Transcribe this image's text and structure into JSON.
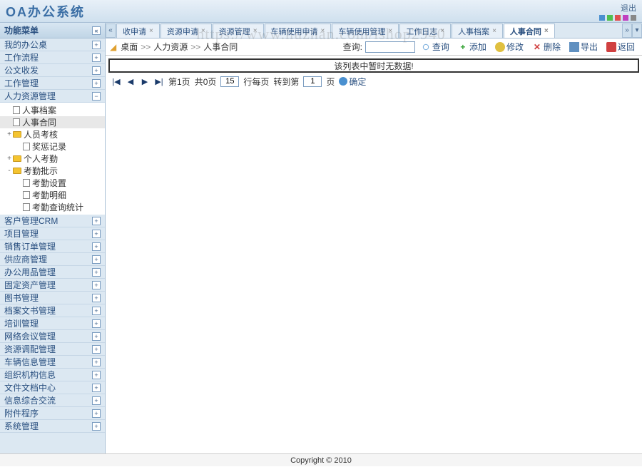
{
  "header": {
    "title": "OA办公系统",
    "logout": "退出"
  },
  "watermark": "https://www.huzhan.com/ishop2940",
  "sidebar": {
    "header": "功能菜单",
    "items": [
      {
        "label": "我的办公桌",
        "expanded": false
      },
      {
        "label": "工作流程",
        "expanded": false
      },
      {
        "label": "公文收发",
        "expanded": false
      },
      {
        "label": "工作管理",
        "expanded": false
      },
      {
        "label": "人力资源管理",
        "expanded": true
      },
      {
        "label": "客户管理CRM",
        "expanded": false
      },
      {
        "label": "项目管理",
        "expanded": false
      },
      {
        "label": "销售订单管理",
        "expanded": false
      },
      {
        "label": "供应商管理",
        "expanded": false
      },
      {
        "label": "办公用品管理",
        "expanded": false
      },
      {
        "label": "固定资产管理",
        "expanded": false
      },
      {
        "label": "图书管理",
        "expanded": false
      },
      {
        "label": "档案文书管理",
        "expanded": false
      },
      {
        "label": "培训管理",
        "expanded": false
      },
      {
        "label": "网络会议管理",
        "expanded": false
      },
      {
        "label": "资源调配管理",
        "expanded": false
      },
      {
        "label": "车辆信息管理",
        "expanded": false
      },
      {
        "label": "组织机构信息",
        "expanded": false
      },
      {
        "label": "文件文档中心",
        "expanded": false
      },
      {
        "label": "信息综合交流",
        "expanded": false
      },
      {
        "label": "附件程序",
        "expanded": false
      },
      {
        "label": "系统管理",
        "expanded": false
      }
    ],
    "tree": [
      {
        "label": "人事档案",
        "type": "file",
        "level": 1
      },
      {
        "label": "人事合同",
        "type": "file",
        "level": 1,
        "selected": true
      },
      {
        "label": "人员考核",
        "type": "folder",
        "level": 1,
        "exp": "+"
      },
      {
        "label": "奖惩记录",
        "type": "file",
        "level": 2
      },
      {
        "label": "个人考勤",
        "type": "folder",
        "level": 1,
        "exp": "+"
      },
      {
        "label": "考勤批示",
        "type": "folder",
        "level": 1,
        "exp": "-"
      },
      {
        "label": "考勤设置",
        "type": "file",
        "level": 2
      },
      {
        "label": "考勤明细",
        "type": "file",
        "level": 2
      },
      {
        "label": "考勤查询统计",
        "type": "file",
        "level": 2
      }
    ]
  },
  "tabs": {
    "items": [
      {
        "label": "收申请"
      },
      {
        "label": "资源申请"
      },
      {
        "label": "资源管理"
      },
      {
        "label": "车辆使用申请"
      },
      {
        "label": "车辆使用管理"
      },
      {
        "label": "工作日志"
      },
      {
        "label": "人事档案"
      },
      {
        "label": "人事合同",
        "active": true
      }
    ]
  },
  "breadcrumb": {
    "root": "桌面",
    "path1": "人力资源",
    "path2": "人事合同",
    "sep": ">>"
  },
  "toolbar": {
    "search_label": "查询:",
    "search_btn": "查询",
    "add": "添加",
    "edit": "修改",
    "delete": "删除",
    "export": "导出",
    "back": "返回"
  },
  "table": {
    "empty_msg": "该列表中暂时无数据!"
  },
  "pager": {
    "page_label": "第1页",
    "total_label": "共0页",
    "rows_value": "15",
    "rows_suffix": "行每页",
    "goto_label": "转到第",
    "goto_value": "1",
    "goto_suffix": "页",
    "confirm": "确定"
  },
  "footer": "Copyright © 2010",
  "colors": {
    "accent": "#3a6ea5"
  }
}
